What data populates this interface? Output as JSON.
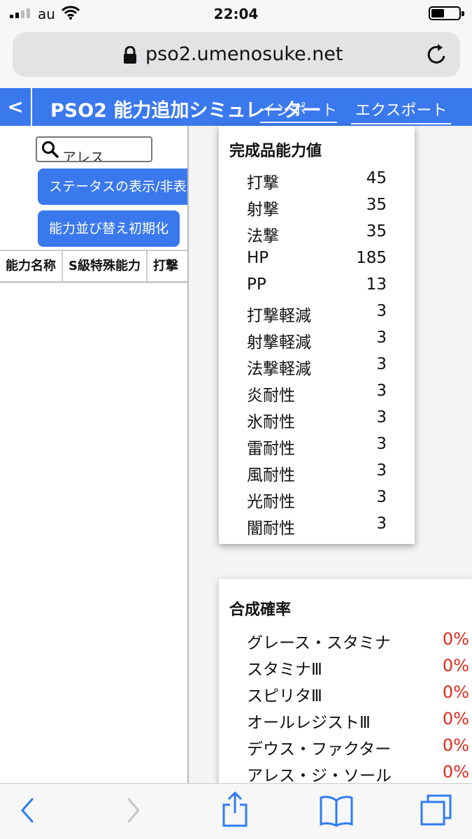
{
  "status": {
    "carrier": "au",
    "time": "22:04"
  },
  "browser": {
    "url": "pso2.umenosuke.net"
  },
  "app": {
    "back_label": "<",
    "title": "PSO2 能力追加シミュレーター",
    "import_label": "インポート",
    "export_label": "エクスポート"
  },
  "left": {
    "search_value": "アレス",
    "toggle_status_label": "ステータスの表示/非表示",
    "reset_sort_label": "能力並び替え初期化",
    "columns": [
      "能力名称",
      "S級特殊能力",
      "打撃"
    ]
  },
  "result": {
    "title": "完成品能力値",
    "stats": [
      {
        "label": "打撃",
        "value": "45"
      },
      {
        "label": "射撃",
        "value": "35"
      },
      {
        "label": "法撃",
        "value": "35"
      },
      {
        "label": "HP",
        "value": "185"
      },
      {
        "label": "PP",
        "value": "13"
      },
      {
        "label": "打撃軽減",
        "value": "3"
      },
      {
        "label": "射撃軽減",
        "value": "3"
      },
      {
        "label": "法撃軽減",
        "value": "3"
      },
      {
        "label": "炎耐性",
        "value": "3"
      },
      {
        "label": "氷耐性",
        "value": "3"
      },
      {
        "label": "雷耐性",
        "value": "3"
      },
      {
        "label": "風耐性",
        "value": "3"
      },
      {
        "label": "光耐性",
        "value": "3"
      },
      {
        "label": "闇耐性",
        "value": "3"
      }
    ]
  },
  "probability": {
    "title": "合成確率",
    "items": [
      {
        "label": "グレース・スタミナ",
        "value": "0%"
      },
      {
        "label": "スタミナⅢ",
        "value": "0%"
      },
      {
        "label": "スピリタⅢ",
        "value": "0%"
      },
      {
        "label": "オールレジストⅢ",
        "value": "0%"
      },
      {
        "label": "デウス・ファクター",
        "value": "0%"
      },
      {
        "label": "アレス・ジ・ソール",
        "value": "0%"
      }
    ]
  },
  "colors": {
    "accent": "#3a78ee",
    "danger": "#e02a1d"
  }
}
